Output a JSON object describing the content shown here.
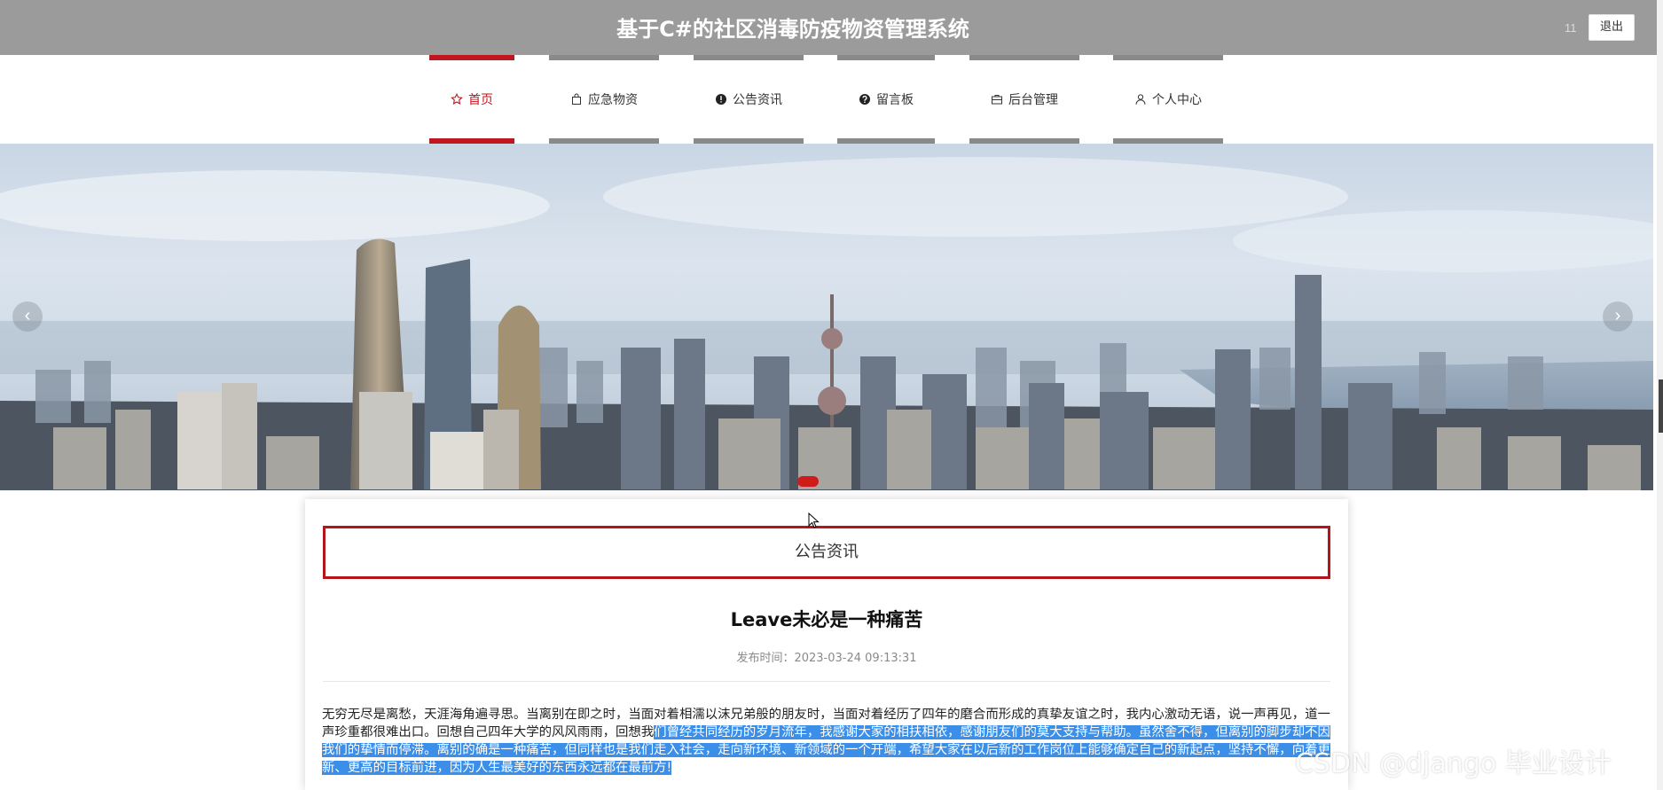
{
  "header": {
    "site_title": "基于C#的社区消毒防疫物资管理系统",
    "user_name": "11",
    "logout_label": "退出"
  },
  "nav": {
    "items": [
      {
        "label": "首页",
        "icon": "star-icon",
        "active": true
      },
      {
        "label": "应急物资",
        "icon": "bag-icon",
        "active": false
      },
      {
        "label": "公告资讯",
        "icon": "exclamation-circle-icon",
        "active": false
      },
      {
        "label": "留言板",
        "icon": "question-circle-icon",
        "active": false
      },
      {
        "label": "后台管理",
        "icon": "briefcase-icon",
        "active": false
      },
      {
        "label": "个人中心",
        "icon": "user-icon",
        "active": false
      }
    ]
  },
  "banner": {
    "prev_icon": "chevron-left-icon",
    "next_icon": "chevron-right-icon",
    "prev_glyph": "‹",
    "next_glyph": "›",
    "slide_count_visible": 1
  },
  "content": {
    "section_title": "公告资讯",
    "article_title": "Leave未必是一种痛苦",
    "publish_label": "发布时间：",
    "publish_time": "2023-03-24 09:13:31",
    "body_plain": "无穷无尽是离愁，天涯海角遍寻思。当离别在即之时，当面对着相濡以沫兄弟般的朋友时，当面对着经历了四年的磨合而形成的真挚友谊之时，我内心激动无语，说一声再见，道一声珍重都很难出口。回想自己四年大学的风风雨雨，回想我",
    "body_highlighted": "们曾经共同经历的岁月流年，我感谢大家的相扶相依，感谢朋友们的莫大支持与帮助。虽然舍不得，但离别的脚步却不因我们的挚情而停滞。离别的确是一种痛苦，但同样也是我们走入社会，走向新环境、新领域的一个开端，希望大家在以后新的工作岗位上能够确定自己的新起点，坚持不懈，向着更新、更高的目标前进，因为人生最美好的东西永远都在最前方!"
  },
  "watermark": "CSDN @django 毕业设计",
  "colors": {
    "header_bg": "#9b9b9b",
    "accent_red": "#c0161d",
    "nav_bar_gray": "#8a8a8a",
    "selection_blue": "#3b8fe8"
  }
}
